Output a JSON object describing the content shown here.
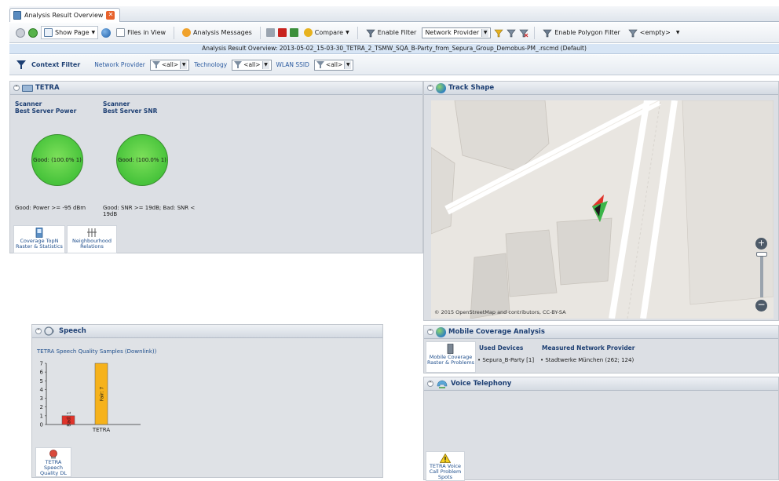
{
  "tab": {
    "title": "Analysis Result Overview",
    "close_label": "✕"
  },
  "toolbar": {
    "show_page": "Show Page",
    "files_in_view": "Files in View",
    "analysis_messages": "Analysis Messages",
    "compare": "Compare",
    "enable_filter": "Enable Filter",
    "filter_select": "Network Provider",
    "enable_polygon_filter": "Enable Polygon Filter",
    "empty_select": "<empty>"
  },
  "overview": {
    "text": "Analysis Result Overview:  2013-05-02_15-03-30_TETRA_2_TSMW_SQA_B-Party_from_Sepura_Group_Demobus-PM_.rscmd (Default)"
  },
  "context_filter": {
    "title": "Context Filter",
    "items": [
      {
        "label": "Network Provider",
        "value": "<all>"
      },
      {
        "label": "Technology",
        "value": "<all>"
      },
      {
        "label": "WLAN SSID",
        "value": "<all>"
      }
    ]
  },
  "tetra": {
    "title": "TETRA",
    "gauges": [
      {
        "title1": "Scanner",
        "title2": "Best Server Power",
        "value": "Good: (100.0% 1)",
        "note": "Good: Power >= -95 dBm"
      },
      {
        "title1": "Scanner",
        "title2": "Best Server SNR",
        "value": "Good: (100.0% 1)",
        "note": "Good: SNR >= 19dB; Bad: SNR < 19dB"
      }
    ],
    "tiles": [
      {
        "label": "Coverage TopN Raster & Statistics"
      },
      {
        "label": "Neighbourhood Relations"
      }
    ]
  },
  "speech": {
    "title": "Speech",
    "tile_label": "TETRA Speech Quality DL"
  },
  "chart_data": {
    "type": "bar",
    "title": "TETRA Speech Quality Samples (Downlink))",
    "categories": [
      "TETRA"
    ],
    "series": [
      {
        "name": "Bad",
        "values": [
          1
        ],
        "color": "#e0332a",
        "label": "Bad: 1"
      },
      {
        "name": "Fair",
        "values": [
          7
        ],
        "color": "#f6b21b",
        "label": "Fair: 7"
      }
    ],
    "yticks": [
      "0",
      "1",
      "2",
      "3",
      "4",
      "5",
      "6",
      "7"
    ],
    "ylim": [
      0,
      7
    ],
    "xlabel": "",
    "ylabel": ""
  },
  "track": {
    "title": "Track Shape",
    "map_credit": "© 2015 OpenStreetMap and contributors, CC-BY-SA"
  },
  "mobile": {
    "title": "Mobile Coverage Analysis",
    "tile_label": "Mobile Coverage Raster & Problems",
    "used_devices_header": "Used Devices",
    "used_devices": "• Sepura_B-Party [1]",
    "provider_header": "Measured Network Provider",
    "provider": "• Stadtwerke München (262; 124)"
  },
  "voice": {
    "title": "Voice Telephony",
    "tile_label": "TETRA Voice Call Problem Spots"
  },
  "colors": {
    "accent": "#1d3f73",
    "good": "#47c33b",
    "bad": "#e0332a",
    "fair": "#f6b21b"
  }
}
